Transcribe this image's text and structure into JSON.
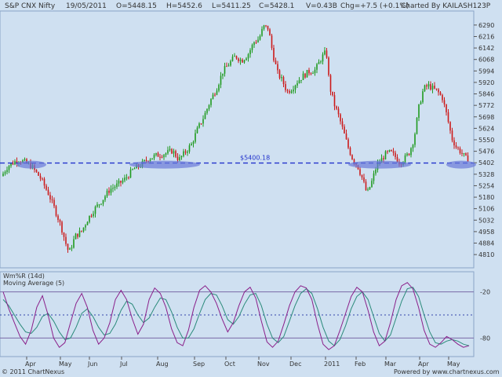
{
  "header": {
    "symbol": "S&P CNX Nifty",
    "date": "19/05/2011",
    "open": "O=5448.15",
    "high": "H=5452.6",
    "low": "L=5411.25",
    "close": "C=5428.1",
    "volume": "V=0.43B",
    "change": "Chg=+7.5 (+0.1%)",
    "charted_by": "Charted By KAILASH123P"
  },
  "footer": {
    "copyright": "© 2011 ChartNexus",
    "powered_by": "Powered by www.chartnexus.com"
  },
  "colors": {
    "background": "#cfe0f1",
    "up_candle": "#1f9a1f",
    "down_candle": "#cc1a1a",
    "support_line": "#2233cc",
    "highlight_ellipse": "#6a79d8",
    "williams_line": "#8a1f8a",
    "moving_average_line": "#2a8a7a"
  },
  "chart_data": [
    {
      "type": "candlestick",
      "title": "S&P CNX Nifty",
      "x_ticks": [
        "Apr",
        "May",
        "Jun",
        "Jul",
        "Aug",
        "Sep",
        "Oct",
        "Nov",
        "Dec",
        "2011",
        "Feb",
        "Mar",
        "Apr",
        "May"
      ],
      "y_ticks": [
        6290,
        6216,
        6142,
        6068,
        5994,
        5920,
        5846,
        5772,
        5698,
        5624,
        5550,
        5476,
        5402,
        5328,
        5254,
        5180,
        5106,
        5032,
        4958,
        4884,
        4810
      ],
      "ylim": [
        4760,
        6340
      ],
      "grid": false,
      "support_level": {
        "label": "$5400.18",
        "value": 5400.18
      },
      "highlight_zones": [
        {
          "from_month": "Apr",
          "to_month": "Apr",
          "level": 5400
        },
        {
          "from_month": "Jul",
          "to_month": "Aug",
          "level": 5400
        },
        {
          "from_month": "Feb",
          "to_month": "Mar",
          "level": 5400
        },
        {
          "from_month": "May",
          "to_month": "May",
          "level": 5400
        }
      ],
      "monthly_close": [
        {
          "month": "Mar 2010",
          "close": 5249
        },
        {
          "month": "Apr 2010",
          "close": 5278
        },
        {
          "month": "May 2010",
          "close": 5087
        },
        {
          "month": "Jun 2010",
          "close": 5313
        },
        {
          "month": "Jul 2010",
          "close": 5368
        },
        {
          "month": "Aug 2010",
          "close": 5402
        },
        {
          "month": "Sep 2010",
          "close": 6030
        },
        {
          "month": "Oct 2010",
          "close": 6018
        },
        {
          "month": "Nov 2010",
          "close": 5863
        },
        {
          "month": "Dec 2010",
          "close": 6135
        },
        {
          "month": "Jan 2011",
          "close": 5506
        },
        {
          "month": "Feb 2011",
          "close": 5333
        },
        {
          "month": "Mar 2011",
          "close": 5834
        },
        {
          "month": "Apr 2011",
          "close": 5749
        },
        {
          "month": "May 2011",
          "close": 5428
        }
      ],
      "path_points": [
        [
          0,
          5300
        ],
        [
          10,
          5380
        ],
        [
          22,
          5420
        ],
        [
          30,
          5410
        ],
        [
          40,
          5380
        ],
        [
          52,
          5300
        ],
        [
          62,
          5200
        ],
        [
          70,
          5100
        ],
        [
          78,
          4990
        ],
        [
          84,
          4880
        ],
        [
          88,
          4820
        ],
        [
          96,
          4930
        ],
        [
          104,
          4960
        ],
        [
          112,
          5040
        ],
        [
          120,
          5100
        ],
        [
          130,
          5160
        ],
        [
          140,
          5230
        ],
        [
          150,
          5260
        ],
        [
          160,
          5300
        ],
        [
          170,
          5360
        ],
        [
          180,
          5390
        ],
        [
          190,
          5430
        ],
        [
          200,
          5450
        ],
        [
          210,
          5460
        ],
        [
          220,
          5480
        ],
        [
          228,
          5420
        ],
        [
          236,
          5470
        ],
        [
          244,
          5520
        ],
        [
          252,
          5620
        ],
        [
          260,
          5700
        ],
        [
          268,
          5800
        ],
        [
          276,
          5880
        ],
        [
          284,
          5990
        ],
        [
          292,
          6040
        ],
        [
          300,
          6090
        ],
        [
          308,
          6060
        ],
        [
          316,
          6100
        ],
        [
          324,
          6180
        ],
        [
          330,
          6200
        ],
        [
          336,
          6280
        ],
        [
          342,
          6270
        ],
        [
          348,
          6100
        ],
        [
          354,
          5980
        ],
        [
          360,
          5930
        ],
        [
          366,
          5860
        ],
        [
          372,
          5880
        ],
        [
          378,
          5920
        ],
        [
          386,
          5960
        ],
        [
          394,
          5990
        ],
        [
          402,
          6000
        ],
        [
          410,
          6080
        ],
        [
          416,
          6120
        ],
        [
          420,
          5900
        ],
        [
          426,
          5780
        ],
        [
          432,
          5700
        ],
        [
          438,
          5600
        ],
        [
          444,
          5500
        ],
        [
          450,
          5420
        ],
        [
          456,
          5380
        ],
        [
          462,
          5300
        ],
        [
          468,
          5200
        ],
        [
          474,
          5280
        ],
        [
          480,
          5380
        ],
        [
          486,
          5420
        ],
        [
          492,
          5460
        ],
        [
          498,
          5470
        ],
        [
          504,
          5440
        ],
        [
          510,
          5400
        ],
        [
          516,
          5430
        ],
        [
          522,
          5470
        ],
        [
          528,
          5560
        ],
        [
          534,
          5760
        ],
        [
          540,
          5880
        ],
        [
          546,
          5900
        ],
        [
          552,
          5880
        ],
        [
          558,
          5860
        ],
        [
          564,
          5820
        ],
        [
          570,
          5700
        ],
        [
          576,
          5560
        ],
        [
          582,
          5500
        ],
        [
          588,
          5470
        ],
        [
          594,
          5430
        ],
        [
          598,
          5428
        ]
      ],
      "label_ids": [
        "header.symbol",
        "chart_data.0.support_level.label"
      ]
    },
    {
      "type": "line",
      "title": "Wm%R (14d)",
      "series": [
        {
          "name": "Wm%R (14d)"
        },
        {
          "name": "Moving Average (5)"
        }
      ],
      "y_ticks": [
        -20,
        -80
      ],
      "ylim": [
        -100,
        0
      ],
      "williams_r": [
        -20,
        -42,
        -60,
        -78,
        -88,
        -70,
        -40,
        -25,
        -50,
        -80,
        -92,
        -86,
        -60,
        -35,
        -22,
        -40,
        -70,
        -88,
        -80,
        -60,
        -30,
        -18,
        -30,
        -55,
        -75,
        -62,
        -30,
        -15,
        -22,
        -40,
        -68,
        -86,
        -90,
        -70,
        -40,
        -18,
        -12,
        -20,
        -35,
        -55,
        -72,
        -60,
        -38,
        -20,
        -14,
        -28,
        -58,
        -85,
        -92,
        -84,
        -62,
        -38,
        -20,
        -12,
        -15,
        -30,
        -62,
        -88,
        -95,
        -90,
        -70,
        -48,
        -26,
        -14,
        -20,
        -44,
        -72,
        -90,
        -84,
        -60,
        -30,
        -12,
        -8,
        -16,
        -40,
        -70,
        -88,
        -92,
        -86,
        -78,
        -82,
        -88,
        -92,
        -90
      ],
      "moving_average": [
        -30,
        -38,
        -50,
        -62,
        -72,
        -74,
        -66,
        -52,
        -48,
        -58,
        -72,
        -82,
        -80,
        -66,
        -48,
        -42,
        -52,
        -66,
        -76,
        -74,
        -62,
        -44,
        -32,
        -36,
        -50,
        -60,
        -54,
        -40,
        -28,
        -30,
        -46,
        -66,
        -80,
        -80,
        -68,
        -48,
        -30,
        -22,
        -24,
        -38,
        -56,
        -62,
        -52,
        -36,
        -24,
        -22,
        -38,
        -62,
        -80,
        -86,
        -78,
        -58,
        -38,
        -22,
        -16,
        -22,
        -42,
        -66,
        -84,
        -90,
        -82,
        -64,
        -42,
        -26,
        -20,
        -30,
        -52,
        -74,
        -84,
        -76,
        -54,
        -32,
        -16,
        -14,
        -26,
        -50,
        -72,
        -86,
        -88,
        -84,
        -82,
        -84,
        -88,
        -90
      ]
    }
  ]
}
